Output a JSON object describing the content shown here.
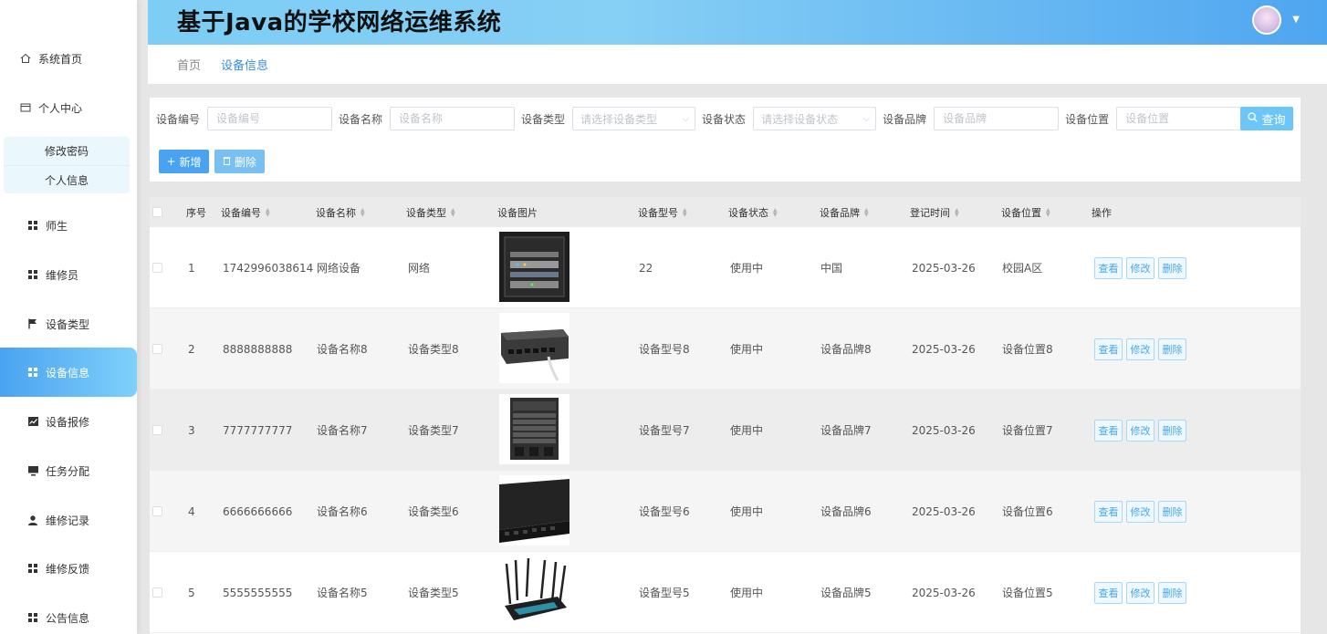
{
  "app": {
    "title": "基于Java的学校网络运维系统"
  },
  "sidebar": {
    "top_items": [
      {
        "label": "系统首页",
        "icon": "home-icon"
      },
      {
        "label": "个人中心",
        "icon": "id-card-icon"
      }
    ],
    "sub_items": [
      {
        "label": "修改密码"
      },
      {
        "label": "个人信息"
      }
    ],
    "items": [
      {
        "label": "师生",
        "icon": "grid-icon"
      },
      {
        "label": "维修员",
        "icon": "grid-icon"
      },
      {
        "label": "设备类型",
        "icon": "flag-icon"
      },
      {
        "label": "设备信息",
        "icon": "grid-icon"
      },
      {
        "label": "设备报修",
        "icon": "chart-icon"
      },
      {
        "label": "任务分配",
        "icon": "monitor-icon"
      },
      {
        "label": "维修记录",
        "icon": "user-icon"
      },
      {
        "label": "维修反馈",
        "icon": "grid-icon"
      },
      {
        "label": "公告信息",
        "icon": "grid-icon"
      }
    ],
    "active_index": 3
  },
  "breadcrumb": {
    "home": "首页",
    "current": "设备信息"
  },
  "search": {
    "fields": [
      {
        "label": "设备编号",
        "type": "input",
        "placeholder": "设备编号",
        "value": ""
      },
      {
        "label": "设备名称",
        "type": "input",
        "placeholder": "设备名称",
        "value": ""
      },
      {
        "label": "设备类型",
        "type": "select",
        "placeholder": "请选择设备类型"
      },
      {
        "label": "设备状态",
        "type": "select",
        "placeholder": "请选择设备状态"
      },
      {
        "label": "设备品牌",
        "type": "input",
        "placeholder": "设备品牌",
        "value": ""
      },
      {
        "label": "设备位置",
        "type": "input",
        "placeholder": "设备位置",
        "value": ""
      }
    ],
    "query_label": "查询",
    "add_label": "新增",
    "delete_label": "删除"
  },
  "table": {
    "columns": [
      "序号",
      "设备编号",
      "设备名称",
      "设备类型",
      "设备图片",
      "设备型号",
      "设备状态",
      "设备品牌",
      "登记时间",
      "设备位置",
      "操作"
    ],
    "rows": [
      {
        "index": "1",
        "code": "1742996038614",
        "name": "网络设备",
        "type": "网络",
        "image": "server-rack",
        "model": "22",
        "status": "使用中",
        "brand": "中国",
        "date": "2025-03-26",
        "location": "校园A区"
      },
      {
        "index": "2",
        "code": "8888888888",
        "name": "设备名称8",
        "type": "设备类型8",
        "image": "network-switch",
        "model": "设备型号8",
        "status": "使用中",
        "brand": "设备品牌8",
        "date": "2025-03-26",
        "location": "设备位置8"
      },
      {
        "index": "3",
        "code": "7777777777",
        "name": "设备名称7",
        "type": "设备类型7",
        "image": "chassis-switch",
        "model": "设备型号7",
        "status": "使用中",
        "brand": "设备品牌7",
        "date": "2025-03-26",
        "location": "设备位置7"
      },
      {
        "index": "4",
        "code": "6666666666",
        "name": "设备名称6",
        "type": "设备类型6",
        "image": "rack-switch",
        "model": "设备型号6",
        "status": "使用中",
        "brand": "设备品牌6",
        "date": "2025-03-26",
        "location": "设备位置6"
      },
      {
        "index": "5",
        "code": "5555555555",
        "name": "设备名称5",
        "type": "设备类型5",
        "image": "wifi-router",
        "model": "设备型号5",
        "status": "使用中",
        "brand": "设备品牌5",
        "date": "2025-03-26",
        "location": "设备位置5"
      }
    ],
    "actions": {
      "view": "查看",
      "edit": "修改",
      "delete": "删除"
    }
  },
  "colors": {
    "accent": "#4aa3f0",
    "header_start": "#7dcdf5",
    "header_end": "#4fa6f0"
  }
}
